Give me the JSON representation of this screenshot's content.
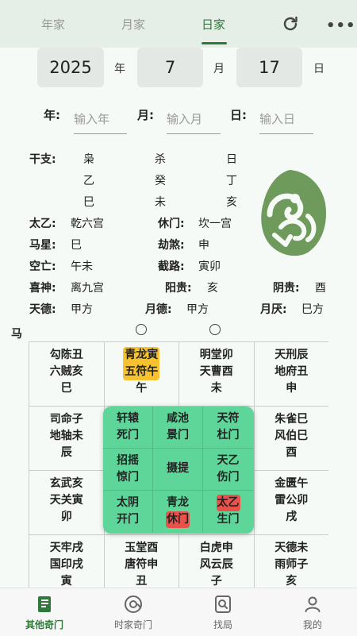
{
  "tabs": [
    {
      "label": "年家"
    },
    {
      "label": "月家"
    },
    {
      "label": "日家"
    }
  ],
  "date": {
    "year_value": "2025",
    "year_unit": "年",
    "month_value": "7",
    "month_unit": "月",
    "day_value": "17",
    "day_unit": "日"
  },
  "inputs": {
    "year_label": "年:",
    "year_placeholder": "输入年",
    "month_label": "月:",
    "month_placeholder": "输入月",
    "day_label": "日:",
    "day_placeholder": "输入日"
  },
  "ganzhi": {
    "label": "干支:",
    "rows": [
      [
        "枭",
        "杀",
        "日"
      ],
      [
        "乙",
        "癸",
        "丁"
      ],
      [
        "巳",
        "未",
        "亥"
      ]
    ]
  },
  "info": {
    "taiyi_label": "太乙:",
    "taiyi_value": "乾六宫",
    "xiumen_label": "休门:",
    "xiumen_value": "坎一宫",
    "maxing_label": "马星:",
    "maxing_value": "巳",
    "jiesha_label": "劫煞:",
    "jiesha_value": "申",
    "kongwang_label": "空亡:",
    "kongwang_value": "午未",
    "jielu_label": "截路:",
    "jielu_value": "寅卯",
    "xishen_label": "喜神:",
    "xishen_value": "离九宫",
    "yanggui_label": "阳贵:",
    "yanggui_value": "亥",
    "yingui_label": "阴贵:",
    "yingui_value": "酉",
    "tiande_label": "天德:",
    "tiande_value": "甲方",
    "yuede_label": "月德:",
    "yuede_value": "甲方",
    "yueyan_label": "月厌:",
    "yueyan_value": "巳方"
  },
  "grid": {
    "ma_label": "马",
    "cells": [
      {
        "l1": "勾陈丑",
        "l2": "六贼亥",
        "l3": "巳"
      },
      {
        "l1": "青龙寅",
        "l2": "五符午",
        "l3": "午",
        "highlight": "yellow"
      },
      {
        "l1": "明堂卯",
        "l2": "天曹酉",
        "l3": "未"
      },
      {
        "l1": "天刑辰",
        "l2": "地府丑",
        "l3": "申"
      },
      {
        "l1": "司命子",
        "l2": "地轴未",
        "l3": "辰"
      },
      {
        "l1": "",
        "l2": "",
        "l3": ""
      },
      {
        "l1": "",
        "l2": "",
        "l3": ""
      },
      {
        "l1": "朱雀巳",
        "l2": "风伯巳",
        "l3": "酉"
      },
      {
        "l1": "玄武亥",
        "l2": "天关寅",
        "l3": "卯"
      },
      {
        "l1": "",
        "l2": "",
        "l3": ""
      },
      {
        "l1": "",
        "l2": "",
        "l3": ""
      },
      {
        "l1": "金匮午",
        "l2": "雷公卯",
        "l3": "戌"
      },
      {
        "l1": "天牢戌",
        "l2": "国印戌",
        "l3": "寅"
      },
      {
        "l1": "玉堂酉",
        "l2": "唐符申",
        "l3": "丑"
      },
      {
        "l1": "白虎申",
        "l2": "风云辰",
        "l3": "子"
      },
      {
        "l1": "天德未",
        "l2": "雨师子",
        "l3": "亥"
      }
    ]
  },
  "palace": [
    {
      "l1": "轩辕",
      "l2": "死门"
    },
    {
      "l1": "咸池",
      "l2": "景门"
    },
    {
      "l1": "天符",
      "l2": "杜门"
    },
    {
      "l1": "招摇",
      "l2": "惊门"
    },
    {
      "l1": "摄提",
      "l2": ""
    },
    {
      "l1": "天乙",
      "l2": "伤门"
    },
    {
      "l1": "太阴",
      "l2": "开门"
    },
    {
      "l1": "青龙",
      "l2": "休门",
      "hl2": "red"
    },
    {
      "l1": "太乙",
      "l2": "生门",
      "hl1": "red"
    }
  ],
  "bottom_nav": [
    {
      "label": "其他奇门",
      "icon": "book-icon"
    },
    {
      "label": "时家奇门",
      "icon": "target-icon"
    },
    {
      "label": "找局",
      "icon": "search-doc-icon"
    },
    {
      "label": "我的",
      "icon": "user-icon"
    }
  ],
  "colors": {
    "accent": "#2f7a3a",
    "panel": "#5ed69a",
    "highlight_yellow": "#f6c230",
    "highlight_red": "#e8524a"
  }
}
